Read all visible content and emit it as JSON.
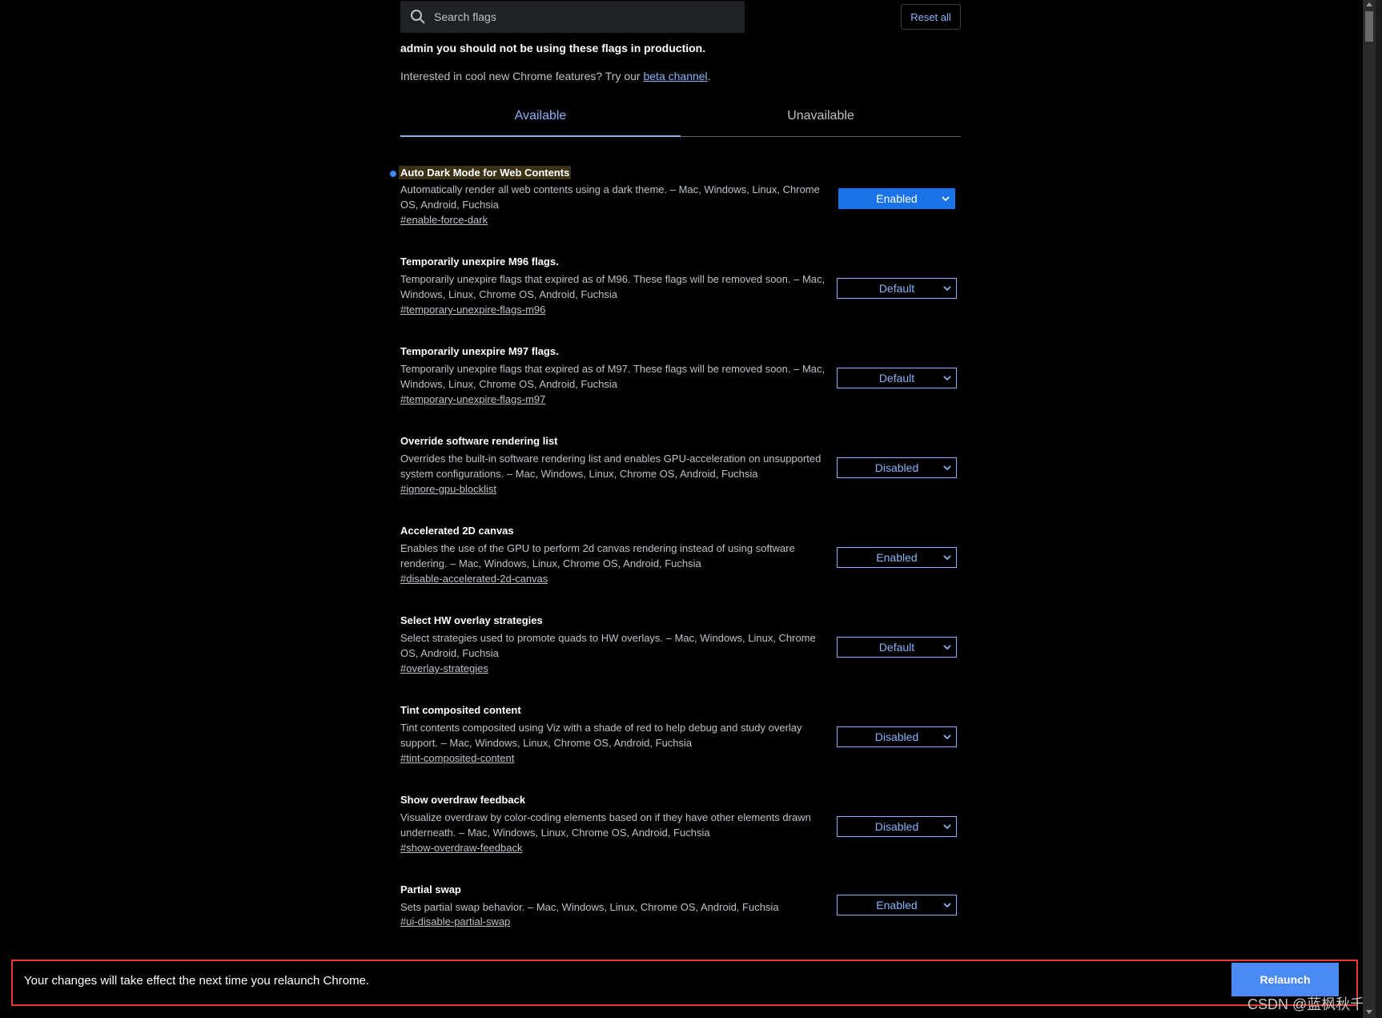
{
  "search": {
    "placeholder": "Search flags"
  },
  "reset_all_label": "Reset all",
  "warning_text": "admin you should not be using these flags in production.",
  "intro": {
    "prefix": "Interested in cool new Chrome features? Try our ",
    "link": "beta channel",
    "suffix": "."
  },
  "tabs": [
    {
      "label": "Available"
    },
    {
      "label": "Unavailable"
    }
  ],
  "flags": [
    {
      "title": "Auto Dark Mode for Web Contents",
      "desc": "Automatically render all web contents using a dark theme. – Mac, Windows, Linux, Chrome OS, Android, Fuchsia",
      "link": "#enable-force-dark",
      "value": "Enabled"
    },
    {
      "title": "Temporarily unexpire M96 flags.",
      "desc": "Temporarily unexpire flags that expired as of M96. These flags will be removed soon. – Mac, Windows, Linux, Chrome OS, Android, Fuchsia",
      "link": "#temporary-unexpire-flags-m96",
      "value": "Default"
    },
    {
      "title": "Temporarily unexpire M97 flags.",
      "desc": "Temporarily unexpire flags that expired as of M97. These flags will be removed soon. – Mac, Windows, Linux, Chrome OS, Android, Fuchsia",
      "link": "#temporary-unexpire-flags-m97",
      "value": "Default"
    },
    {
      "title": "Override software rendering list",
      "desc": "Overrides the built-in software rendering list and enables GPU-acceleration on unsupported system configurations. – Mac, Windows, Linux, Chrome OS, Android, Fuchsia",
      "link": "#ignore-gpu-blocklist",
      "value": "Disabled"
    },
    {
      "title": "Accelerated 2D canvas",
      "desc": "Enables the use of the GPU to perform 2d canvas rendering instead of using software rendering. – Mac, Windows, Linux, Chrome OS, Android, Fuchsia",
      "link": "#disable-accelerated-2d-canvas",
      "value": "Enabled"
    },
    {
      "title": "Select HW overlay strategies",
      "desc": "Select strategies used to promote quads to HW overlays. – Mac, Windows, Linux, Chrome OS, Android, Fuchsia",
      "link": "#overlay-strategies",
      "value": "Default"
    },
    {
      "title": "Tint composited content",
      "desc": "Tint contents composited using Viz with a shade of red to help debug and study overlay support. – Mac, Windows, Linux, Chrome OS, Android, Fuchsia",
      "link": "#tint-composited-content",
      "value": "Disabled"
    },
    {
      "title": "Show overdraw feedback",
      "desc": "Visualize overdraw by color-coding elements based on if they have other elements drawn underneath. – Mac, Windows, Linux, Chrome OS, Android, Fuchsia",
      "link": "#show-overdraw-feedback",
      "value": "Disabled"
    },
    {
      "title": "Partial swap",
      "desc": "Sets partial swap behavior. – Mac, Windows, Linux, Chrome OS, Android, Fuchsia",
      "link": "#ui-disable-partial-swap",
      "value": "Enabled"
    }
  ],
  "banner": {
    "message": "Your changes will take effect the next time you relaunch Chrome.",
    "relaunch_label": "Relaunch"
  },
  "watermark": "CSDN @蓝枫秋千",
  "colors": {
    "accent": "#8ab4f8",
    "primary_button": "#4a8af4",
    "highlight_border": "#e53935"
  }
}
